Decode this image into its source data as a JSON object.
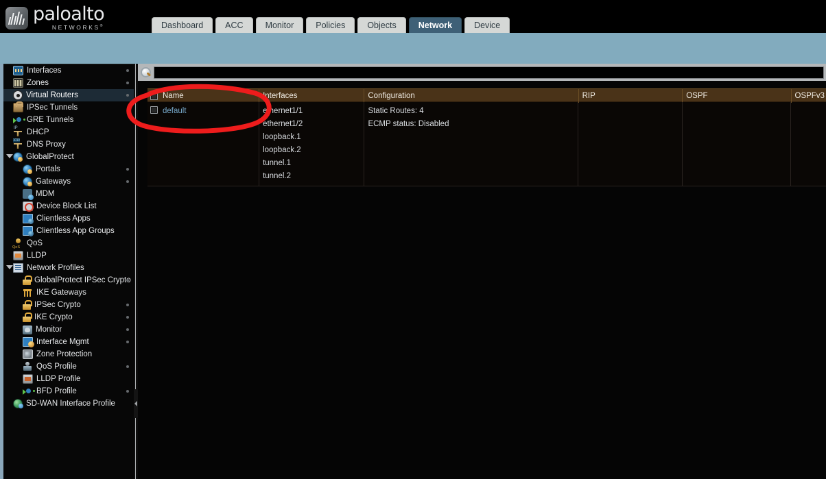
{
  "brand": {
    "name": "paloalto",
    "tagline": "NETWORKS",
    "trademark": "®"
  },
  "tabs": [
    {
      "label": "Dashboard",
      "active": false
    },
    {
      "label": "ACC",
      "active": false
    },
    {
      "label": "Monitor",
      "active": false
    },
    {
      "label": "Policies",
      "active": false
    },
    {
      "label": "Objects",
      "active": false
    },
    {
      "label": "Network",
      "active": true
    },
    {
      "label": "Device",
      "active": false
    }
  ],
  "sidebar": {
    "items": [
      {
        "label": "Interfaces",
        "icon": "interfaces-icon",
        "level": 0,
        "selected": false,
        "dot": true,
        "caret": false
      },
      {
        "label": "Zones",
        "icon": "zones-icon",
        "level": 0,
        "selected": false,
        "dot": true,
        "caret": false
      },
      {
        "label": "Virtual Routers",
        "icon": "virtual-router-icon",
        "level": 0,
        "selected": true,
        "dot": true,
        "caret": false
      },
      {
        "label": "IPSec Tunnels",
        "icon": "ipsec-tunnel-icon",
        "level": 0,
        "selected": false,
        "dot": false,
        "caret": false
      },
      {
        "label": "GRE Tunnels",
        "icon": "gre-tunnel-icon",
        "level": 0,
        "selected": false,
        "dot": false,
        "caret": false
      },
      {
        "label": "DHCP",
        "icon": "dhcp-icon",
        "level": 0,
        "selected": false,
        "dot": false,
        "caret": false
      },
      {
        "label": "DNS Proxy",
        "icon": "dns-proxy-icon",
        "level": 0,
        "selected": false,
        "dot": false,
        "caret": false
      },
      {
        "label": "GlobalProtect",
        "icon": "globalprotect-icon",
        "level": 0,
        "selected": false,
        "dot": false,
        "caret": true
      },
      {
        "label": "Portals",
        "icon": "portal-icon",
        "level": 1,
        "selected": false,
        "dot": true,
        "caret": false
      },
      {
        "label": "Gateways",
        "icon": "gateway-icon",
        "level": 1,
        "selected": false,
        "dot": true,
        "caret": false
      },
      {
        "label": "MDM",
        "icon": "mdm-icon",
        "level": 1,
        "selected": false,
        "dot": false,
        "caret": false
      },
      {
        "label": "Device Block List",
        "icon": "device-block-icon",
        "level": 1,
        "selected": false,
        "dot": false,
        "caret": false
      },
      {
        "label": "Clientless Apps",
        "icon": "clientless-apps-icon",
        "level": 1,
        "selected": false,
        "dot": false,
        "caret": false
      },
      {
        "label": "Clientless App Groups",
        "icon": "clientless-groups-icon",
        "level": 1,
        "selected": false,
        "dot": false,
        "caret": false
      },
      {
        "label": "QoS",
        "icon": "qos-icon",
        "level": 0,
        "selected": false,
        "dot": false,
        "caret": false
      },
      {
        "label": "LLDP",
        "icon": "lldp-icon",
        "level": 0,
        "selected": false,
        "dot": false,
        "caret": false
      },
      {
        "label": "Network Profiles",
        "icon": "network-profiles-icon",
        "level": 0,
        "selected": false,
        "dot": false,
        "caret": true
      },
      {
        "label": "GlobalProtect IPSec Crypto",
        "icon": "lock-icon",
        "level": 1,
        "selected": false,
        "dot": true,
        "caret": false
      },
      {
        "label": "IKE Gateways",
        "icon": "ike-gateway-icon",
        "level": 1,
        "selected": false,
        "dot": false,
        "caret": false
      },
      {
        "label": "IPSec Crypto",
        "icon": "lock-icon",
        "level": 1,
        "selected": false,
        "dot": true,
        "caret": false
      },
      {
        "label": "IKE Crypto",
        "icon": "lock-icon",
        "level": 1,
        "selected": false,
        "dot": true,
        "caret": false
      },
      {
        "label": "Monitor",
        "icon": "monitor-icon",
        "level": 1,
        "selected": false,
        "dot": true,
        "caret": false
      },
      {
        "label": "Interface Mgmt",
        "icon": "interface-mgmt-icon",
        "level": 1,
        "selected": false,
        "dot": true,
        "caret": false
      },
      {
        "label": "Zone Protection",
        "icon": "zone-protection-icon",
        "level": 1,
        "selected": false,
        "dot": false,
        "caret": false
      },
      {
        "label": "QoS Profile",
        "icon": "qos-profile-icon",
        "level": 1,
        "selected": false,
        "dot": true,
        "caret": false
      },
      {
        "label": "LLDP Profile",
        "icon": "lldp-profile-icon",
        "level": 1,
        "selected": false,
        "dot": false,
        "caret": false
      },
      {
        "label": "BFD Profile",
        "icon": "bfd-profile-icon",
        "level": 1,
        "selected": false,
        "dot": true,
        "caret": false
      },
      {
        "label": "SD-WAN Interface Profile",
        "icon": "sdwan-icon",
        "level": 0,
        "selected": false,
        "dot": false,
        "caret": false
      }
    ]
  },
  "search": {
    "value": "",
    "placeholder": ""
  },
  "table": {
    "columns": [
      {
        "key": "name",
        "label": "Name"
      },
      {
        "key": "intf",
        "label": "Interfaces"
      },
      {
        "key": "conf",
        "label": "Configuration"
      },
      {
        "key": "rip",
        "label": "RIP"
      },
      {
        "key": "ospf",
        "label": "OSPF"
      },
      {
        "key": "ospfv3",
        "label": "OSPFv3"
      }
    ],
    "rows": [
      {
        "name": "default",
        "interfaces": [
          "ethernet1/1",
          "ethernet1/2",
          "loopback.1",
          "loopback.2",
          "tunnel.1",
          "tunnel.2"
        ],
        "configuration": [
          "Static Routes: 4",
          "ECMP status: Disabled"
        ],
        "rip": [],
        "ospf": [],
        "ospfv3": []
      }
    ]
  },
  "annotation": {
    "shape": "red-ellipse",
    "color": "#ee1c1c"
  },
  "colors": {
    "header_band": "#82abbe",
    "table_header": "#4a3318",
    "tab_active": "#3e6077",
    "link": "#77a8c9",
    "selected_nav": "#1d2b36"
  }
}
